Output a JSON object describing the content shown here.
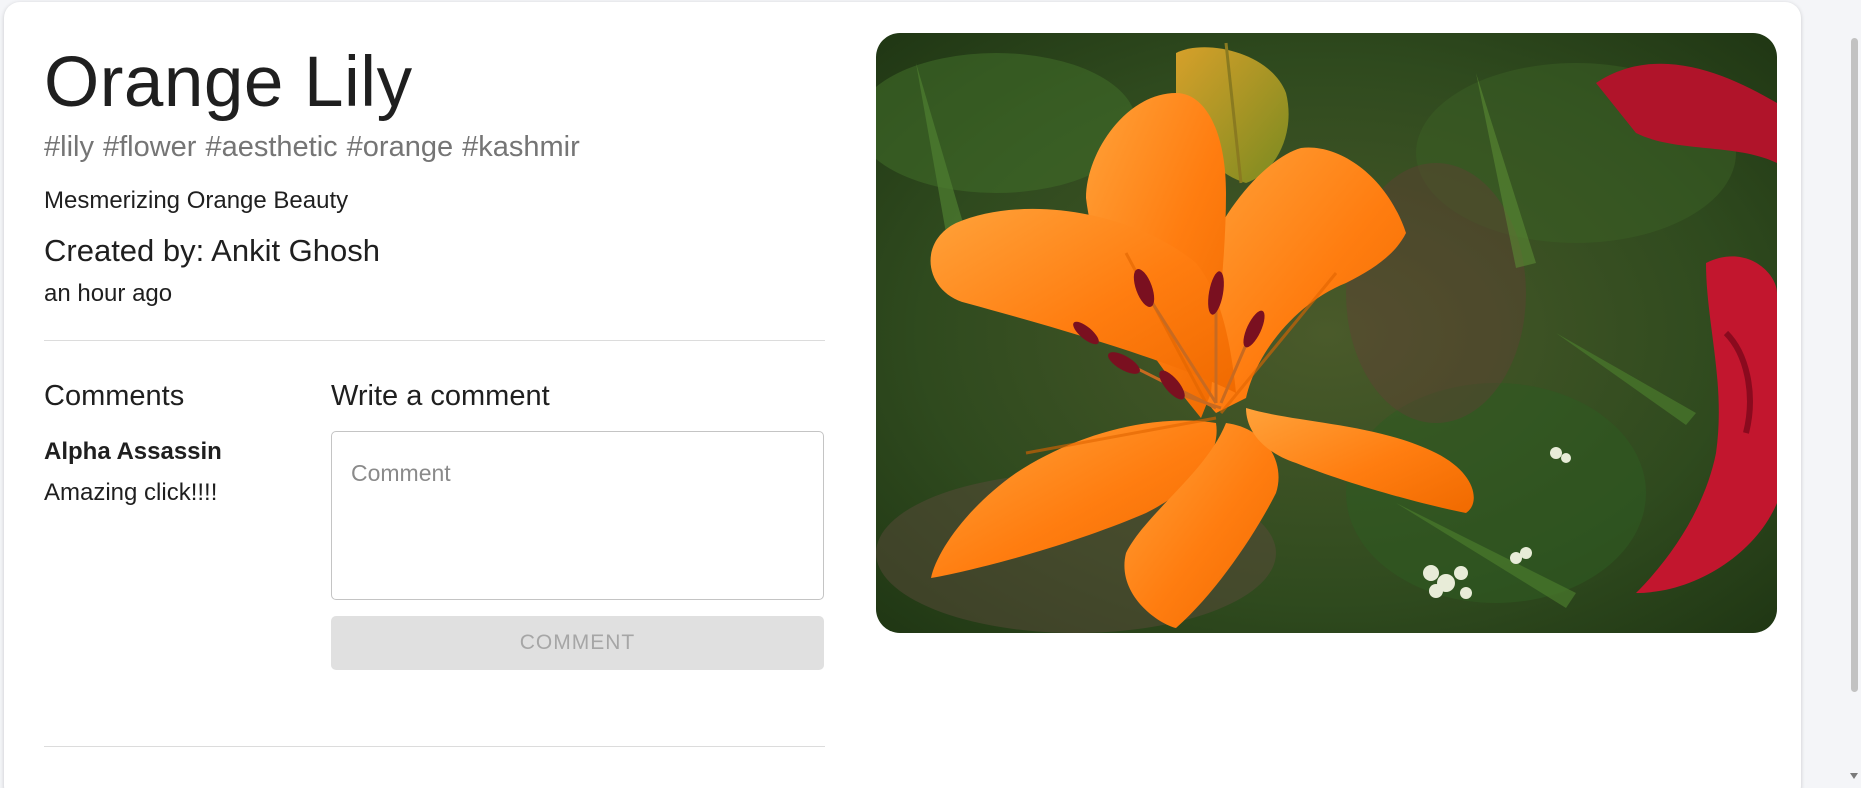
{
  "post": {
    "title": "Orange Lily",
    "tags": [
      "#lily",
      "#flower",
      "#aesthetic",
      "#orange",
      "#kashmir"
    ],
    "message": "Mesmerizing Orange Beauty",
    "created_by": "Created by: Ankit Ghosh",
    "time_ago": "an hour ago"
  },
  "comments": {
    "heading": "Comments",
    "items": [
      {
        "author": "Alpha Assassin",
        "text": "Amazing click!!!!"
      }
    ]
  },
  "write_comment": {
    "heading": "Write a comment",
    "placeholder": "Comment",
    "button_label": "COMMENT"
  },
  "photo": {
    "icon": "orange-lily-photo"
  },
  "colors": {
    "card_background": "#ffffff",
    "page_background": "#f4f5f8",
    "tag_text": "#757575",
    "button_disabled_bg": "#e0e0e0",
    "button_disabled_text": "#a6a6a6",
    "lily_orange": "#ff7d10"
  }
}
